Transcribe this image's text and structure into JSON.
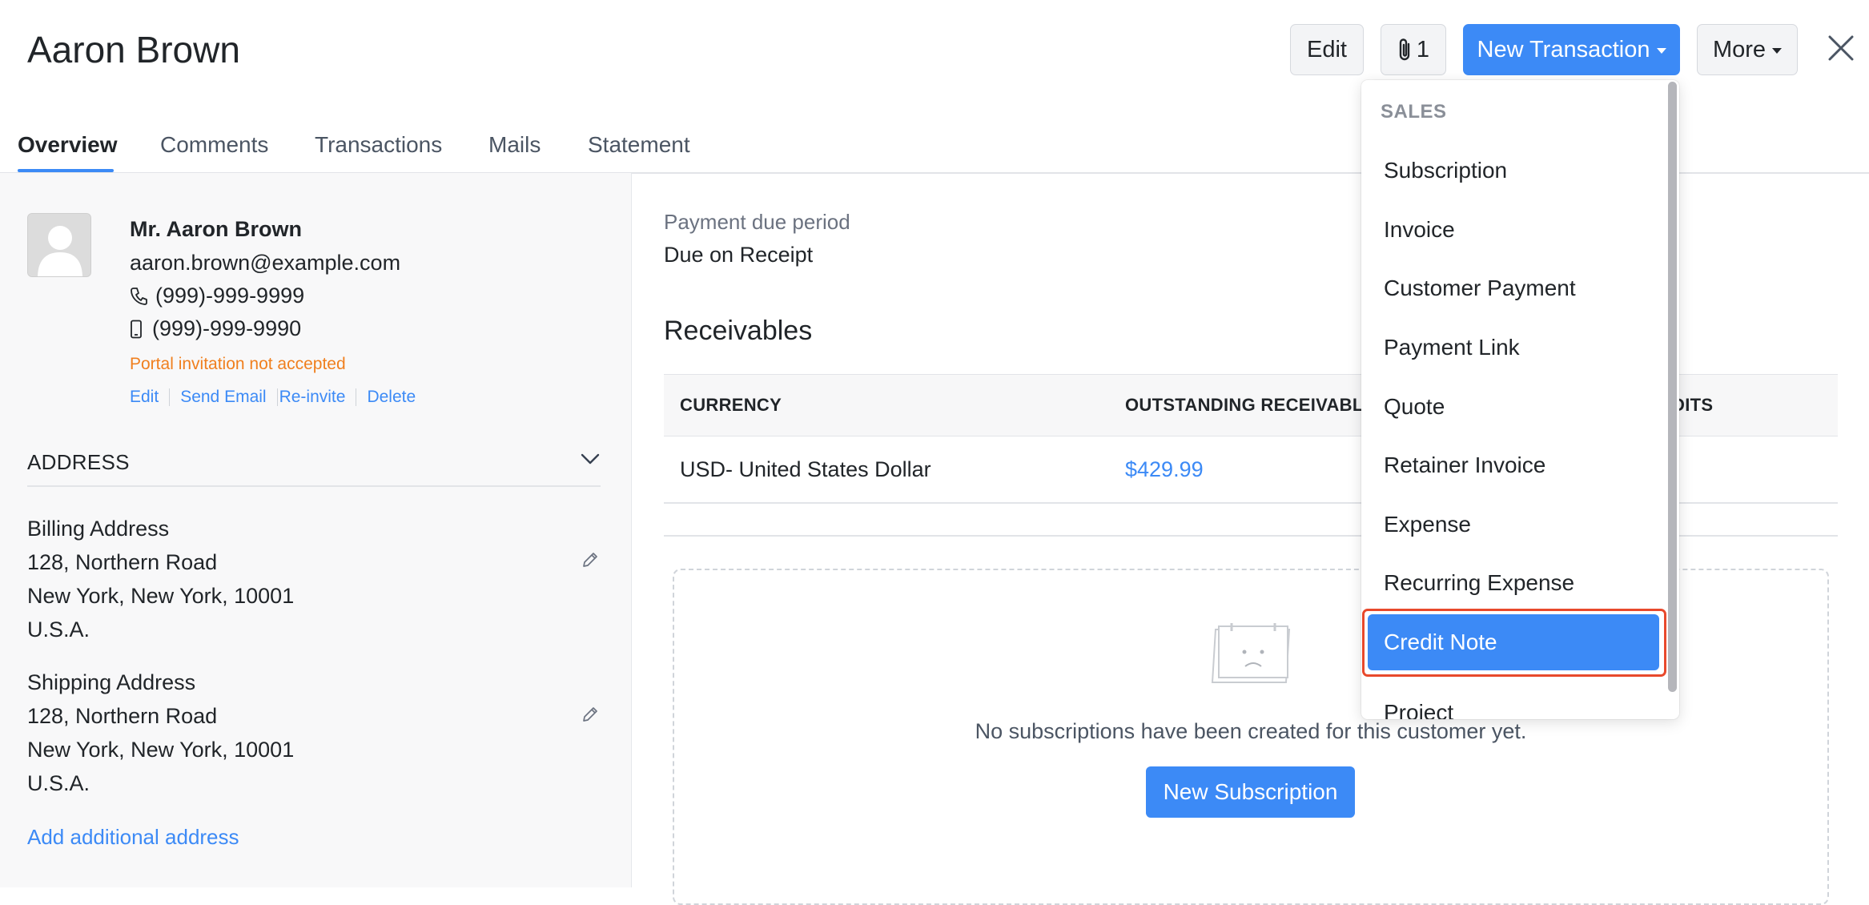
{
  "header": {
    "title": "Aaron Brown",
    "edit_label": "Edit",
    "attachment_count": "1",
    "new_transaction_label": "New Transaction",
    "more_label": "More"
  },
  "tabs": [
    {
      "label": "Overview",
      "active": true
    },
    {
      "label": "Comments"
    },
    {
      "label": "Transactions"
    },
    {
      "label": "Mails"
    },
    {
      "label": "Statement"
    }
  ],
  "contact": {
    "name": "Mr. Aaron Brown",
    "email": "aaron.brown@example.com",
    "phone": "(999)-999-9999",
    "mobile": "(999)-999-9990",
    "portal_status": "Portal invitation not accepted",
    "actions": [
      "Edit",
      "Send Email",
      "Re-invite",
      "Delete"
    ]
  },
  "address_section": {
    "title": "ADDRESS",
    "billing": {
      "label": "Billing Address",
      "line1": "128, Northern Road",
      "line2": "New York, New York, 10001",
      "line3": "U.S.A."
    },
    "shipping": {
      "label": "Shipping Address",
      "line1": "128, Northern Road",
      "line2": "New York, New York, 10001",
      "line3": "U.S.A."
    },
    "add_link": "Add additional address"
  },
  "payment": {
    "label": "Payment due period",
    "value": "Due on Receipt"
  },
  "receivables": {
    "title": "Receivables",
    "columns": [
      "CURRENCY",
      "OUTSTANDING RECEIVABLI",
      "DITS"
    ],
    "rows": [
      {
        "currency": "USD- United States Dollar",
        "outstanding": "$429.99"
      }
    ]
  },
  "subscriptions_empty": {
    "message": "No subscriptions have been created for this customer yet.",
    "button": "New Subscription"
  },
  "dropdown": {
    "section": "SALES",
    "items": [
      "Subscription",
      "Invoice",
      "Customer Payment",
      "Payment Link",
      "Quote",
      "Retainer Invoice",
      "Expense",
      "Recurring Expense",
      "Credit Note",
      "Project"
    ],
    "active_item": "Credit Note"
  },
  "colors": {
    "accent": "#3c8af6",
    "warning": "#f07f1e",
    "highlight_border": "#e8492c"
  }
}
